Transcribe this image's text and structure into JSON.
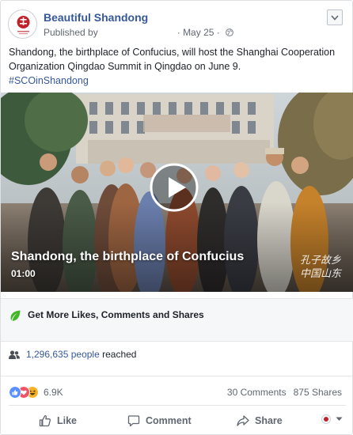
{
  "post": {
    "page_name": "Beautiful Shandong",
    "published_by": "Published by",
    "date": "May 25",
    "separator": "·",
    "text": "Shandong, the birthplace of Confucius, will host the Shanghai Cooperation Organization Qingdao Summit in Qingdao on June 9.",
    "hashtag": "#SCOinShandong"
  },
  "video": {
    "title": "Shandong, the birthplace of Confucius",
    "duration": "01:00",
    "calligraphy_line1": "孔子故乡",
    "calligraphy_line2": "中国山东"
  },
  "promo": {
    "label": "Get More Likes, Comments and Shares"
  },
  "reach": {
    "count": "1,296,635 people",
    "suffix": "reached"
  },
  "engagement": {
    "reaction_count": "6.9K",
    "comments": "30 Comments",
    "shares": "875 Shares"
  },
  "actions": {
    "like": "Like",
    "comment": "Comment",
    "share": "Share"
  },
  "icons": {
    "globe": "globe-icon",
    "chevron": "chevron-down-icon",
    "play": "play-icon",
    "leaf": "leaf-icon",
    "people": "people-icon",
    "like_reaction": "like-reaction-icon",
    "love_reaction": "love-reaction-icon",
    "haha_reaction": "haha-reaction-icon"
  },
  "colors": {
    "link": "#365899",
    "muted": "#616770",
    "promo_bg": "#f6f7f9",
    "leaf_green": "#42b72a",
    "like_blue": "#5890ff",
    "love_red": "#f25268",
    "haha_yellow": "#f7b125"
  }
}
